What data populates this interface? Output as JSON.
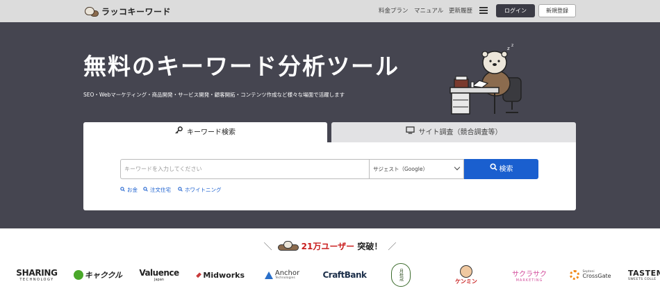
{
  "header": {
    "logo_text": "ラッコキーワード",
    "nav": [
      "料金プラン",
      "マニュアル",
      "更新履歴"
    ],
    "login_label": "ログイン",
    "register_label": "新規登録"
  },
  "hero": {
    "title": "無料のキーワード分析ツール",
    "subtitle": "SEO・Webマーケティング・商品開発・サービス開発・顧客開拓・コンテンツ作成など様々な場面で活躍します"
  },
  "search": {
    "tabs": [
      {
        "label": "キーワード検索",
        "icon": "key-icon",
        "active": true
      },
      {
        "label": "サイト調査（競合調査等）",
        "icon": "monitor-icon",
        "active": false
      }
    ],
    "placeholder": "キーワードを入力してください",
    "select_value": "サジェスト（Google）",
    "button_label": "検索",
    "suggestions": [
      "お金",
      "注文住宅",
      "ホワイトニング"
    ]
  },
  "users": {
    "count_text": "21万ユーザー",
    "suffix": "突破！"
  },
  "logos": [
    {
      "name": "SHARING",
      "sub": "TECHNOLOGY"
    },
    {
      "name": "キャククル",
      "sub": ""
    },
    {
      "name": "Valuence",
      "sub": "Japan"
    },
    {
      "name": "Midworks",
      "sub": ""
    },
    {
      "name": "Anchor",
      "sub": "Technologies"
    },
    {
      "name": "CraftBank",
      "sub": ""
    },
    {
      "name": "月桂冠",
      "sub": ""
    },
    {
      "name": "ケンミン",
      "sub": ""
    },
    {
      "name": "サクラサク",
      "sub": "MARKETING"
    },
    {
      "name": "CrossGate",
      "sub": "Septeni"
    },
    {
      "name": "TASTEM",
      "sub": "SWEETS COLLE"
    }
  ],
  "colors": {
    "hero_bg": "#454550",
    "header_bg": "#dcdcdc",
    "primary": "#1a5fcf",
    "login_bg": "#3b3b45",
    "accent_red": "#c91e1e"
  }
}
